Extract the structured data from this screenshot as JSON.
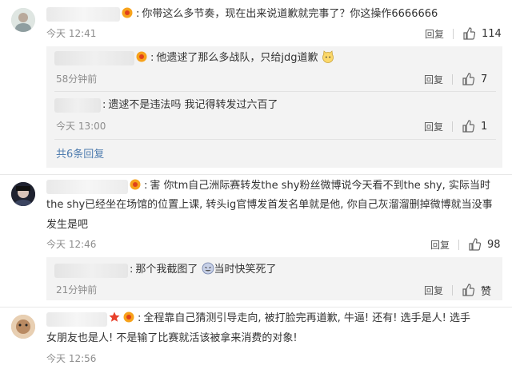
{
  "comments": [
    {
      "text": "你带这么多节奏，现在出来说道歉就完事了？你这操作6666666",
      "time": "今天 12:41",
      "reply_label": "回复",
      "likes": "114",
      "replies": [
        {
          "text": "他遗逑了那么多战队，只给jdg道歉",
          "time": "58分钟前",
          "reply_label": "回复",
          "likes": "7"
        },
        {
          "text": "遗逑不是违法吗 我记得转发过六百了",
          "time": "今天 13:00",
          "reply_label": "回复",
          "likes": "1"
        }
      ],
      "more_replies": "共6条回复"
    },
    {
      "text_line1": "害 你tm自己洲际赛转发the shy粉丝微博说今天看不到the shy, 实际当时",
      "text_line2": "the shy已经坐在场馆的位置上课, 转头ig官博发首发名单就是他, 你自己灰溜溜删掉微博就当没事",
      "text_line3": "发生是吧",
      "time": "今天 12:46",
      "reply_label": "回复",
      "likes": "98",
      "replies": [
        {
          "text_a": "那个我截图了",
          "text_b": "当时快笑死了",
          "time": "21分钟前",
          "reply_label": "回复",
          "likes": "赞"
        }
      ]
    },
    {
      "text_line1": "全程靠自己猜测引导走向, 被打脸完再道歉, 牛逼! 还有! 选手是人! 选手",
      "text_line2": "女朋友也是人! 不是输了比赛就活该被拿来消费的对象!",
      "time": "今天 12:56"
    }
  ],
  "colors": {
    "link": "#507daf",
    "subBg": "#f3f3f3",
    "badge": "#f7a21b"
  },
  "icons": [
    "thumb-up-icon",
    "vip-badge-icon",
    "cat-emoji-icon",
    "laugh-emoji-icon",
    "star-icon"
  ]
}
